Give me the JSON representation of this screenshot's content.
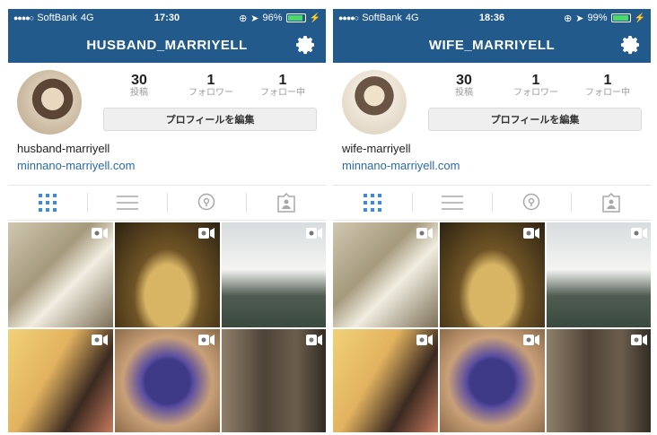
{
  "status": {
    "carrier": "SoftBank",
    "network": "4G"
  },
  "phones": [
    {
      "time": "17:30",
      "battery": "96%",
      "battery_level": 0.96,
      "username_title": "HUSBAND_MARRIYELL",
      "stats": [
        {
          "num": "30",
          "label": "投稿"
        },
        {
          "num": "1",
          "label": "フォロワー"
        },
        {
          "num": "1",
          "label": "フォロー中"
        }
      ],
      "edit_button": "プロフィールを編集",
      "bio_name": "husband-marriyell",
      "bio_link": "minnano-marriyell.com"
    },
    {
      "time": "18:36",
      "battery": "99%",
      "battery_level": 0.99,
      "username_title": "WIFE_MARRIYELL",
      "stats": [
        {
          "num": "30",
          "label": "投稿"
        },
        {
          "num": "1",
          "label": "フォロワー"
        },
        {
          "num": "1",
          "label": "フォロー中"
        }
      ],
      "edit_button": "プロフィールを編集",
      "bio_name": "wife-marriyell",
      "bio_link": "minnano-marriyell.com"
    }
  ],
  "tabs": [
    "grid-icon",
    "list-icon",
    "location-icon",
    "tagged-icon"
  ],
  "colors": {
    "header": "#235a8c",
    "link": "#2b6aa6",
    "active_tab": "#3b8be0",
    "inactive_tab": "#a8a8a8"
  }
}
